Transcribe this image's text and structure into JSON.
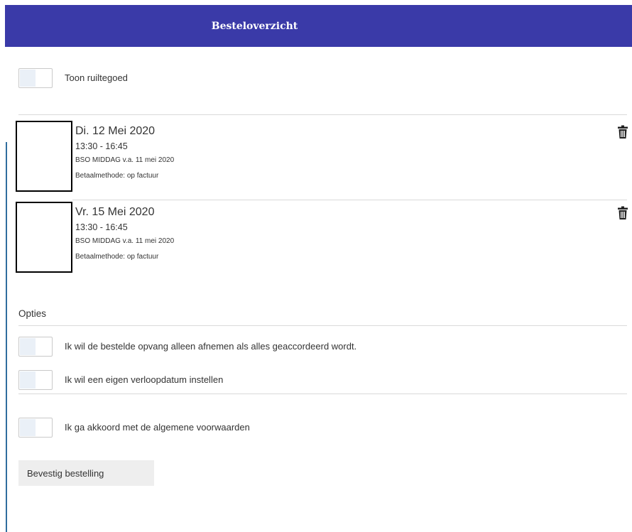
{
  "header": {
    "title": "Besteloverzicht"
  },
  "toggles": {
    "exchange_credit": {
      "label": "Toon ruiltegoed",
      "on": false
    }
  },
  "orders": [
    {
      "date": "Di. 12 Mei 2020",
      "time": "13:30 - 16:45",
      "product": "BSO MIDDAG v.a. 11 mei 2020",
      "payment": "Betaalmethode: op factuur",
      "delete_icon": "trash-icon"
    },
    {
      "date": "Vr. 15 Mei 2020",
      "time": "13:30 - 16:45",
      "product": "BSO MIDDAG v.a. 11 mei 2020",
      "payment": "Betaalmethode: op factuur",
      "delete_icon": "trash-icon"
    }
  ],
  "options": {
    "title": "Opties",
    "only_if_all_approved": {
      "label": "Ik wil de bestelde opvang alleen afnemen als alles geaccordeerd wordt.",
      "on": false
    },
    "custom_expiry": {
      "label": "Ik wil een eigen verloopdatum instellen",
      "on": false
    },
    "accept_terms": {
      "label": "Ik ga akkoord met de algemene voorwaarden",
      "on": false
    }
  },
  "confirm_button": {
    "label": "Bevestig bestelling"
  },
  "colors": {
    "header_bg": "#3a3aa8",
    "accent_line": "#2f6d9e",
    "toggle_knob": "#eaf0f7",
    "button_bg": "#eeeeee"
  }
}
